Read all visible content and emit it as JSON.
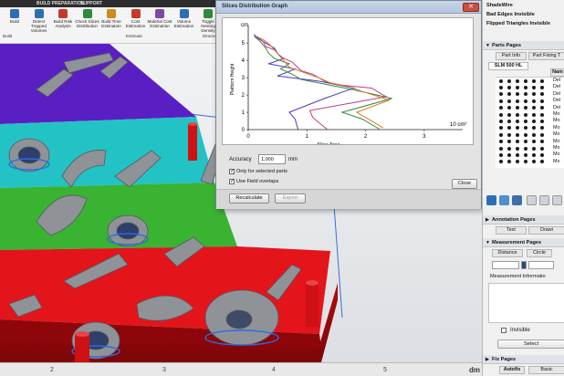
{
  "ribbon": {
    "tabs": [
      "",
      "BUILD PREPARATION",
      "SUPPORT",
      "",
      ""
    ],
    "buttons": [
      {
        "label": "Build",
        "icon": "build-icon",
        "color": "#2d6fb7"
      },
      {
        "label": "Detect Trapped Volumes",
        "icon": "trapped-volume-icon",
        "color": "#2d6fb7"
      },
      {
        "label": "Build Risk Analysis",
        "icon": "risk-analysis-icon",
        "color": "#c53b2b"
      },
      {
        "label": "Check Slices Distribution",
        "icon": "slices-icon",
        "color": "#2e8b3a"
      },
      {
        "label": "Build Time Estimation",
        "icon": "clock-icon",
        "color": "#d08a1d"
      },
      {
        "label": "Cost Estimation",
        "icon": "cost-icon",
        "color": "#c53b2b"
      },
      {
        "label": "Material Cost Estimation",
        "icon": "material-cost-icon",
        "color": "#7a4aa8"
      },
      {
        "label": "Volume Estimation",
        "icon": "volume-icon",
        "color": "#2d6fb7"
      },
      {
        "label": "Toggle Nesting Density",
        "icon": "nesting-icon",
        "color": "#2e8b3a"
      }
    ],
    "row2": [
      "Build",
      "",
      "",
      "Estimate",
      "",
      "Dimensi"
    ]
  },
  "viewport": {
    "ruler": {
      "ticks": [
        "2",
        "3",
        "4",
        "5"
      ],
      "unit": "dm"
    },
    "layer_colors": [
      "#5a1fc2",
      "#23c2c5",
      "#39b331",
      "#e4141b"
    ]
  },
  "dialog": {
    "title": "Slices Distribution Graph",
    "close_glyph": "✕",
    "graph": {
      "y_axis_label": "Platform Height",
      "y_unit": "cm",
      "x_axis_label": "Slice Area",
      "x_unit": "10 cm²",
      "y_ticks": [
        "0",
        "1",
        "2",
        "3",
        "4",
        "5"
      ],
      "x_ticks": [
        "0",
        "1",
        "2",
        "3"
      ]
    },
    "accuracy_label": "Accuracy",
    "accuracy_value": "1,000",
    "accuracy_unit": "mm",
    "only_selected_label": "Only for selected parts",
    "only_selected_checked": "✓",
    "use_field_overlaps_label": "Use Field overlaps",
    "use_field_overlaps_checked": "✓",
    "recalculate_label": "Recalculate",
    "export_label": "Export",
    "close_label": "Close"
  },
  "chart_data": {
    "type": "line",
    "title": "Slices Distribution Graph",
    "xlabel": "Slice Area",
    "ylabel": "Platform Height",
    "x_unit": "10 cm²",
    "y_unit": "cm",
    "xlim": [
      0,
      3.5
    ],
    "ylim": [
      0,
      5.8
    ],
    "grid": false,
    "series": [
      {
        "color": "#4a37c9",
        "x": [
          0.85,
          0.8,
          0.7,
          1.3,
          1.8,
          1.2,
          0.5,
          0.8,
          0.35,
          0.6,
          0.5,
          0.45,
          0.3,
          0.15,
          0.1
        ],
        "y": [
          0.0,
          0.6,
          1.0,
          1.8,
          2.4,
          2.8,
          3.1,
          3.5,
          3.8,
          4.1,
          4.4,
          4.7,
          5.0,
          5.3,
          5.5
        ]
      },
      {
        "color": "#2e8b3a",
        "x": [
          2.25,
          1.95,
          1.6,
          2.45,
          1.8,
          1.35,
          0.9,
          0.75,
          0.55,
          0.7,
          0.45,
          0.35,
          0.3,
          0.2,
          0.1
        ],
        "y": [
          0.0,
          0.6,
          1.0,
          1.8,
          2.3,
          2.6,
          2.9,
          3.2,
          3.5,
          3.8,
          4.1,
          4.4,
          4.7,
          5.1,
          5.4
        ]
      },
      {
        "color": "#c4368f",
        "x": [
          1.35,
          1.1,
          1.05,
          2.35,
          2.1,
          1.5,
          1.3,
          1.1,
          0.9,
          0.75,
          0.55,
          0.45,
          0.3,
          0.25,
          0.15
        ],
        "y": [
          0.0,
          0.7,
          1.1,
          1.9,
          2.4,
          2.6,
          2.8,
          3.2,
          3.4,
          3.9,
          4.2,
          4.6,
          4.8,
          5.1,
          5.4
        ]
      },
      {
        "color": "#d87a1e",
        "x": [
          2.3,
          2.05,
          1.85,
          2.4,
          1.95,
          1.7,
          1.4,
          1.2,
          0.95,
          0.7,
          0.6,
          0.5,
          0.4,
          0.3,
          0.2
        ],
        "y": [
          0.1,
          0.6,
          1.0,
          1.7,
          2.2,
          2.5,
          2.7,
          3.0,
          3.3,
          3.6,
          4.0,
          4.4,
          4.8,
          5.1,
          5.3
        ]
      }
    ]
  },
  "right_panel": {
    "options": [
      "ShadeWire",
      "Bad Edges Invisible",
      "Flipped Triangles Invisible"
    ],
    "parts_pages_header": "Parts Pages",
    "part_info_tab": "Part Info",
    "part_fixing_tab": "Part Fixing T",
    "machine_label": "SLM 500 HL",
    "name_header": "Nam",
    "parts": [
      "Del",
      "Del",
      "Del",
      "Del",
      "Del",
      "Mo",
      "Mo",
      "Mo",
      "Mo",
      "Mo",
      "Mo",
      "Mo",
      "Mo"
    ],
    "annotation_pages_header": "Annotation Pages",
    "text_tab": "Text",
    "drawing_tab": "Drawi",
    "measurement_pages_header": "Measurement Pages",
    "distance_tab": "Distance",
    "circle_tab": "Circle",
    "measurement_info_label": "Measurement Informatio",
    "invisible_label": "Invisible",
    "select_label": "Select",
    "fix_pages_header": "Fix Pages",
    "autofix_tab": "Autofix",
    "basic_tab": "Basic"
  }
}
